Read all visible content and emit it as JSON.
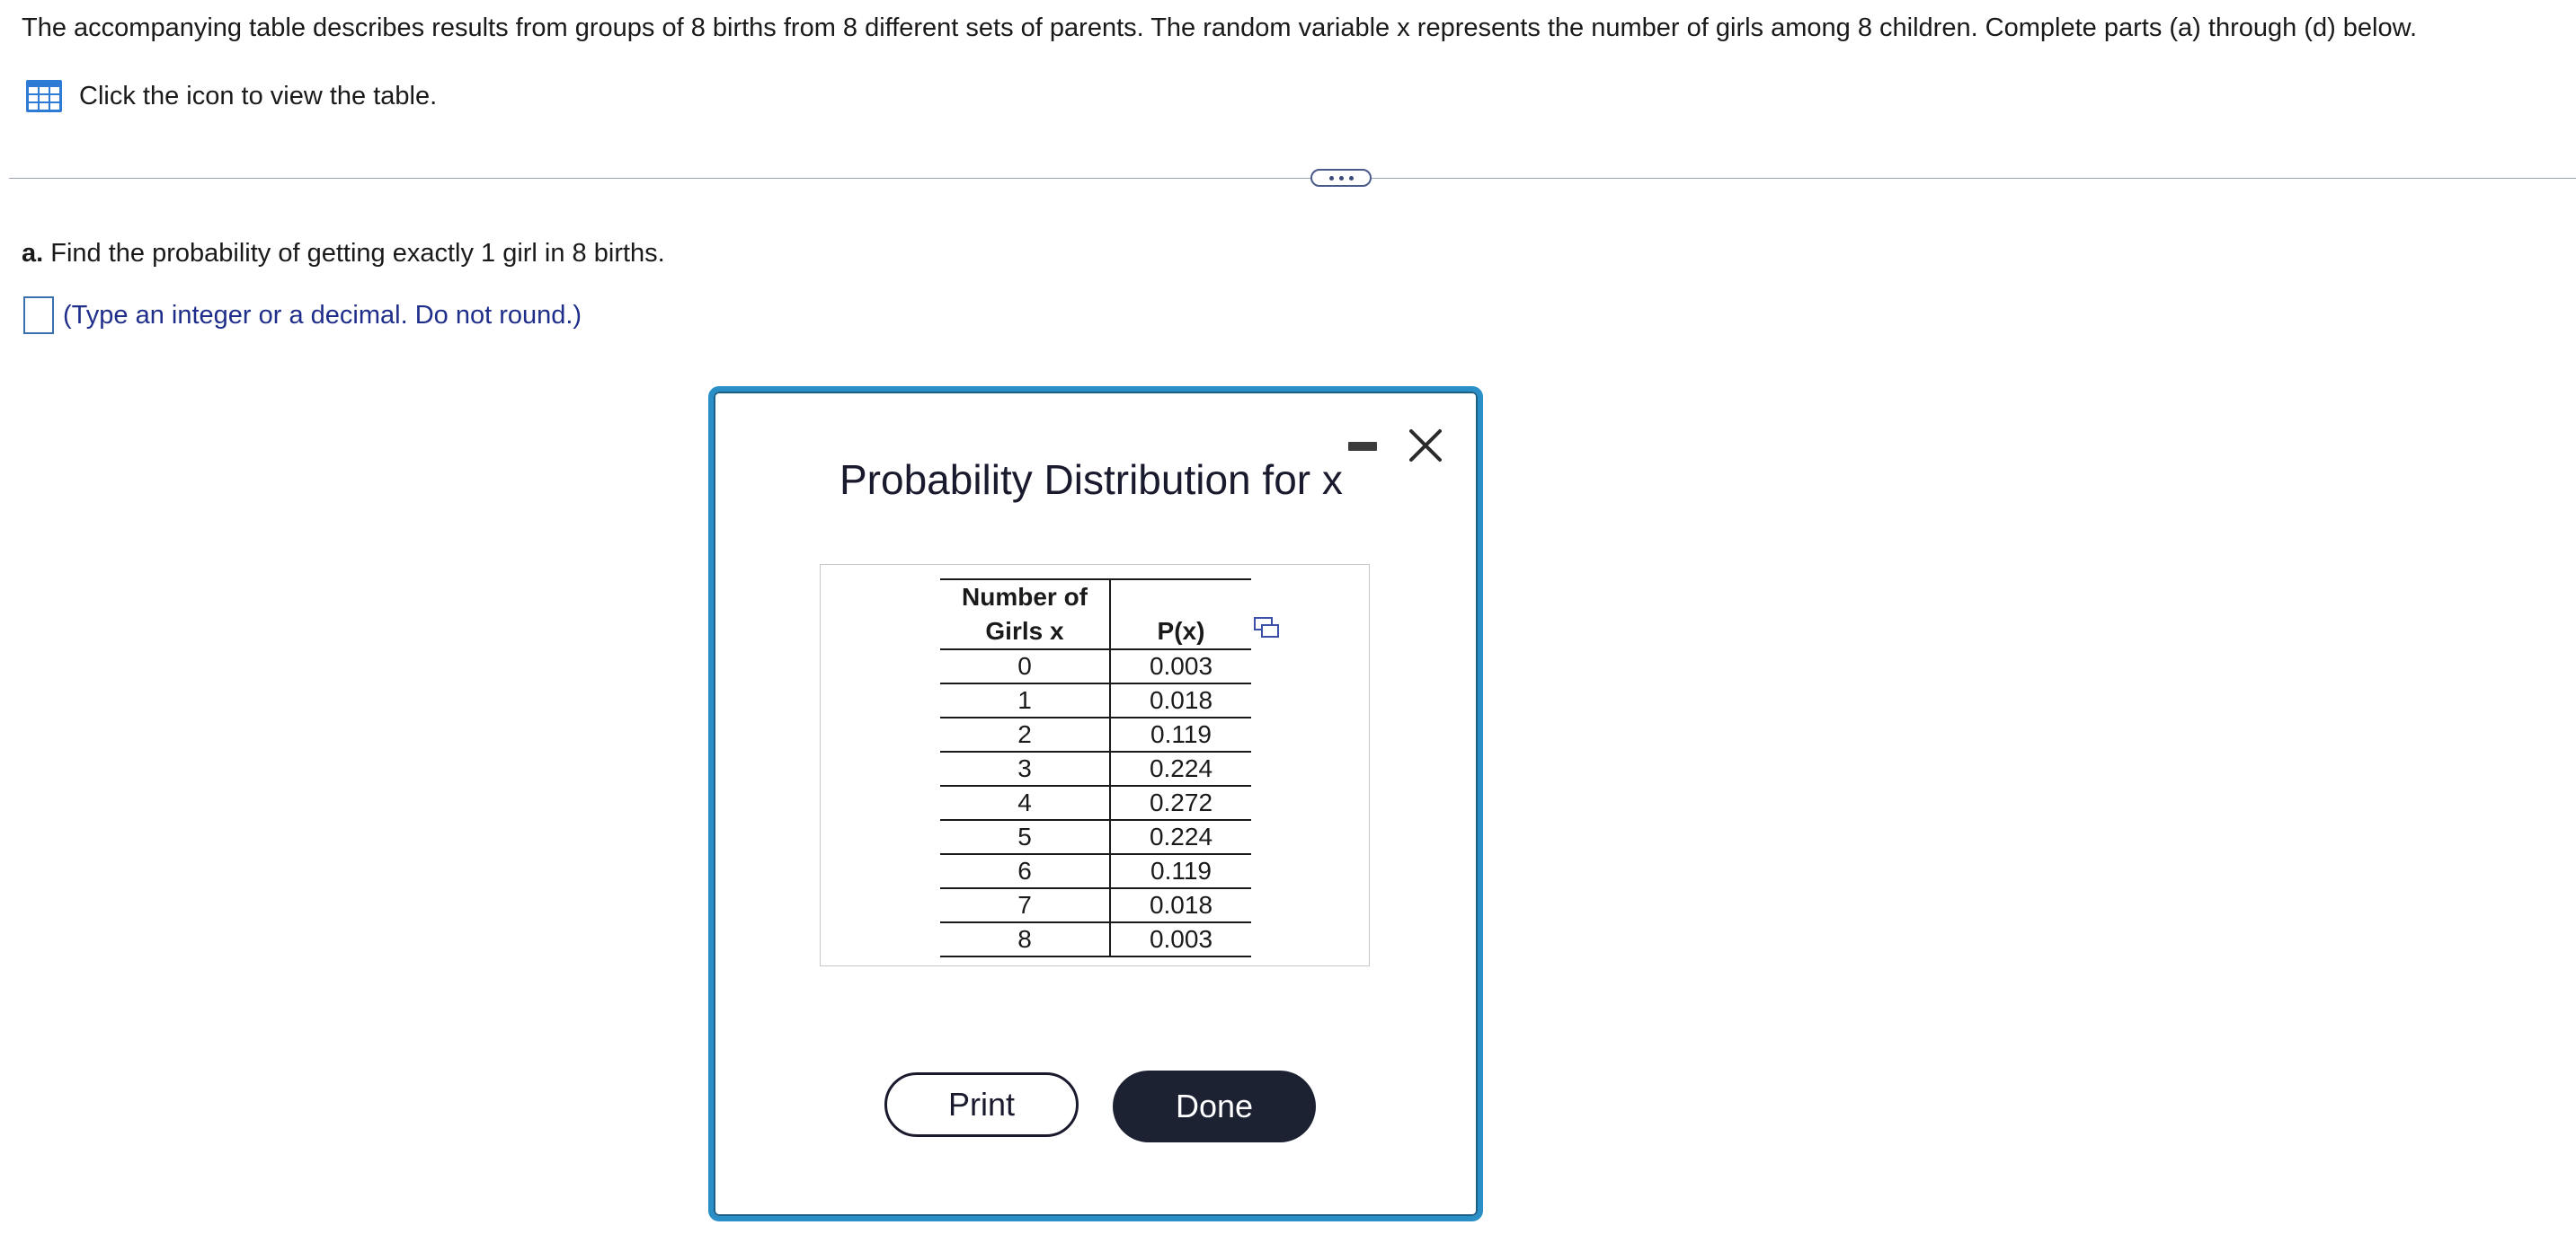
{
  "question": {
    "text": "The accompanying table describes results from groups of 8 births from 8 different sets of parents. The random variable x represents the number of girls among 8 children. Complete parts (a) through (d) below."
  },
  "table_link": {
    "icon": "table-grid-icon",
    "label": "Click the icon to view the table."
  },
  "part_a": {
    "prefix": "a.",
    "text": " Find the probability of getting exactly 1 girl in 8 births.",
    "answer_value": "",
    "hint": "(Type an integer or a decimal. Do not round.)"
  },
  "modal": {
    "title": "Probability Distribution for x",
    "header_x_line1": "Number of",
    "header_x_line2": "Girls x",
    "header_p": "P(x)",
    "rows": [
      {
        "x": "0",
        "p": "0.003"
      },
      {
        "x": "1",
        "p": "0.018"
      },
      {
        "x": "2",
        "p": "0.119"
      },
      {
        "x": "3",
        "p": "0.224"
      },
      {
        "x": "4",
        "p": "0.272"
      },
      {
        "x": "5",
        "p": "0.224"
      },
      {
        "x": "6",
        "p": "0.119"
      },
      {
        "x": "7",
        "p": "0.018"
      },
      {
        "x": "8",
        "p": "0.003"
      }
    ],
    "print_label": "Print",
    "done_label": "Done"
  },
  "colors": {
    "accent_border": "#2a8fc7",
    "done_button": "#1d2233",
    "hint_text": "#1f2e8a",
    "answer_box_border": "#3a6fb0"
  }
}
